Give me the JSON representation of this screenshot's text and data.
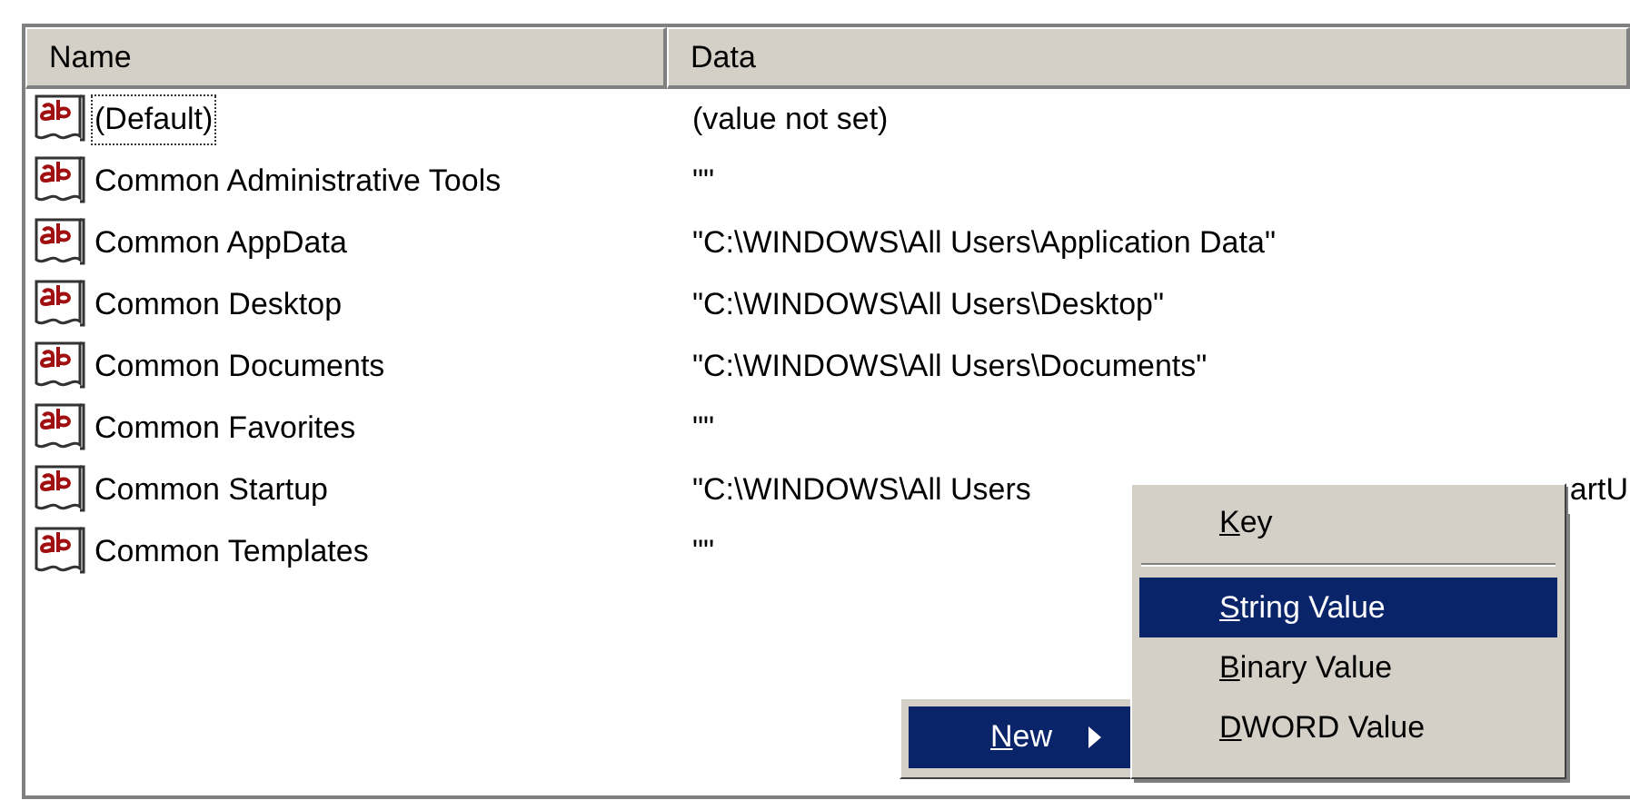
{
  "table": {
    "columns": [
      {
        "label": "Name"
      },
      {
        "label": "Data"
      }
    ],
    "rows": [
      {
        "name": "(Default)",
        "data": "(value not set)",
        "selected": true
      },
      {
        "name": "Common Administrative Tools",
        "data": "\"\"",
        "selected": false
      },
      {
        "name": "Common AppData",
        "data": "\"C:\\WINDOWS\\All Users\\Application Data\"",
        "selected": false
      },
      {
        "name": "Common Desktop",
        "data": "\"C:\\WINDOWS\\All Users\\Desktop\"",
        "selected": false
      },
      {
        "name": "Common Documents",
        "data": "\"C:\\WINDOWS\\All Users\\Documents\"",
        "selected": false
      },
      {
        "name": "Common Favorites",
        "data": "\"\"",
        "selected": false
      },
      {
        "name": "Common Startup",
        "data": "\"C:\\WINDOWS\\All Users",
        "data_tail": "artU",
        "selected": false
      },
      {
        "name": "Common Templates",
        "data": "\"\"",
        "selected": false
      }
    ]
  },
  "context_menu": {
    "items": [
      {
        "accel": "N",
        "label_rest": "ew",
        "selected": true
      }
    ]
  },
  "submenu": {
    "items": [
      {
        "kind": "item",
        "accel": "K",
        "label_rest": "ey",
        "selected": false
      },
      {
        "kind": "separator"
      },
      {
        "kind": "item",
        "accel": "S",
        "label_rest": "tring Value",
        "selected": true
      },
      {
        "kind": "item",
        "accel": "B",
        "label_rest": "inary Value",
        "selected": false
      },
      {
        "kind": "item",
        "accel": "D",
        "label_rest": "WORD Value",
        "selected": false
      }
    ]
  }
}
